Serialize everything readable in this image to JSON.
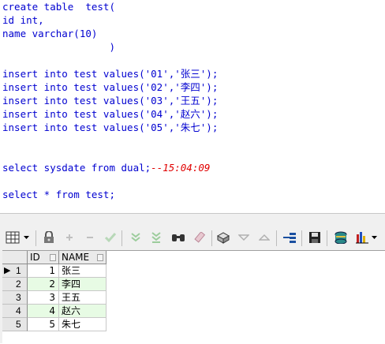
{
  "editor": {
    "lines": [
      "create table  test(",
      "id int,",
      "name varchar(10)",
      "                  )",
      "insert into test values('01','张三');",
      "insert into test values('02','李四');",
      "insert into test values('03','王五');",
      "insert into test values('04','赵六');",
      "insert into test values('05','朱七');",
      "select sysdate from dual;",
      "select * from test;"
    ],
    "comment": "--15:04:09"
  },
  "toolbar": {
    "icons": [
      "grid-view-icon",
      "dropdown-arrow-icon",
      "lock-icon",
      "add-record-icon",
      "delete-record-icon",
      "post-record-icon",
      "fetch-next-icon",
      "fetch-last-icon",
      "find-icon",
      "clear-icon",
      "query-by-example-icon",
      "previous-icon",
      "next-icon",
      "record-navigator-icon",
      "save-icon",
      "export-icon",
      "chart-icon",
      "dropdown-arrow-icon"
    ]
  },
  "grid": {
    "columns": [
      "ID",
      "NAME"
    ],
    "rows": [
      {
        "rownum": "1",
        "id": "1",
        "name": "张三"
      },
      {
        "rownum": "2",
        "id": "2",
        "name": "李四"
      },
      {
        "rownum": "3",
        "id": "3",
        "name": "王五"
      },
      {
        "rownum": "4",
        "id": "4",
        "name": "赵六"
      },
      {
        "rownum": "5",
        "id": "5",
        "name": "朱七"
      }
    ],
    "current_row_marker": "▶",
    "colors": {
      "alt_row": "#e7fbe4",
      "keyword": "#0000d0",
      "comment": "#e00000"
    }
  }
}
